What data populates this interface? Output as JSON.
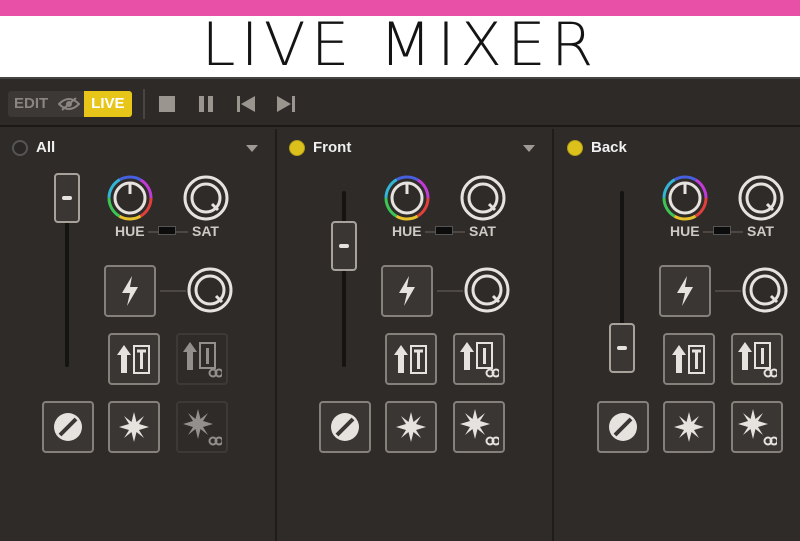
{
  "header": {
    "title": "LIVE MIXER",
    "accent_color": "#e84fa6"
  },
  "toolbar": {
    "modes": {
      "edit_label": "EDIT",
      "live_label": "LIVE",
      "live_color": "#e7c619"
    },
    "transport": [
      "stop-icon",
      "pause-icon",
      "skip-back-icon",
      "skip-forward-icon"
    ]
  },
  "channels": [
    {
      "name": "All",
      "active": false,
      "fader_level": 0.85,
      "hue_label": "HUE",
      "sat_label": "SAT"
    },
    {
      "name": "Front",
      "active": true,
      "fader_level": 0.6,
      "hue_label": "HUE",
      "sat_label": "SAT"
    },
    {
      "name": "Back",
      "active": true,
      "fader_level": 0.2,
      "hue_label": "HUE",
      "sat_label": "SAT"
    }
  ],
  "indicator_color": "#dcc11c"
}
